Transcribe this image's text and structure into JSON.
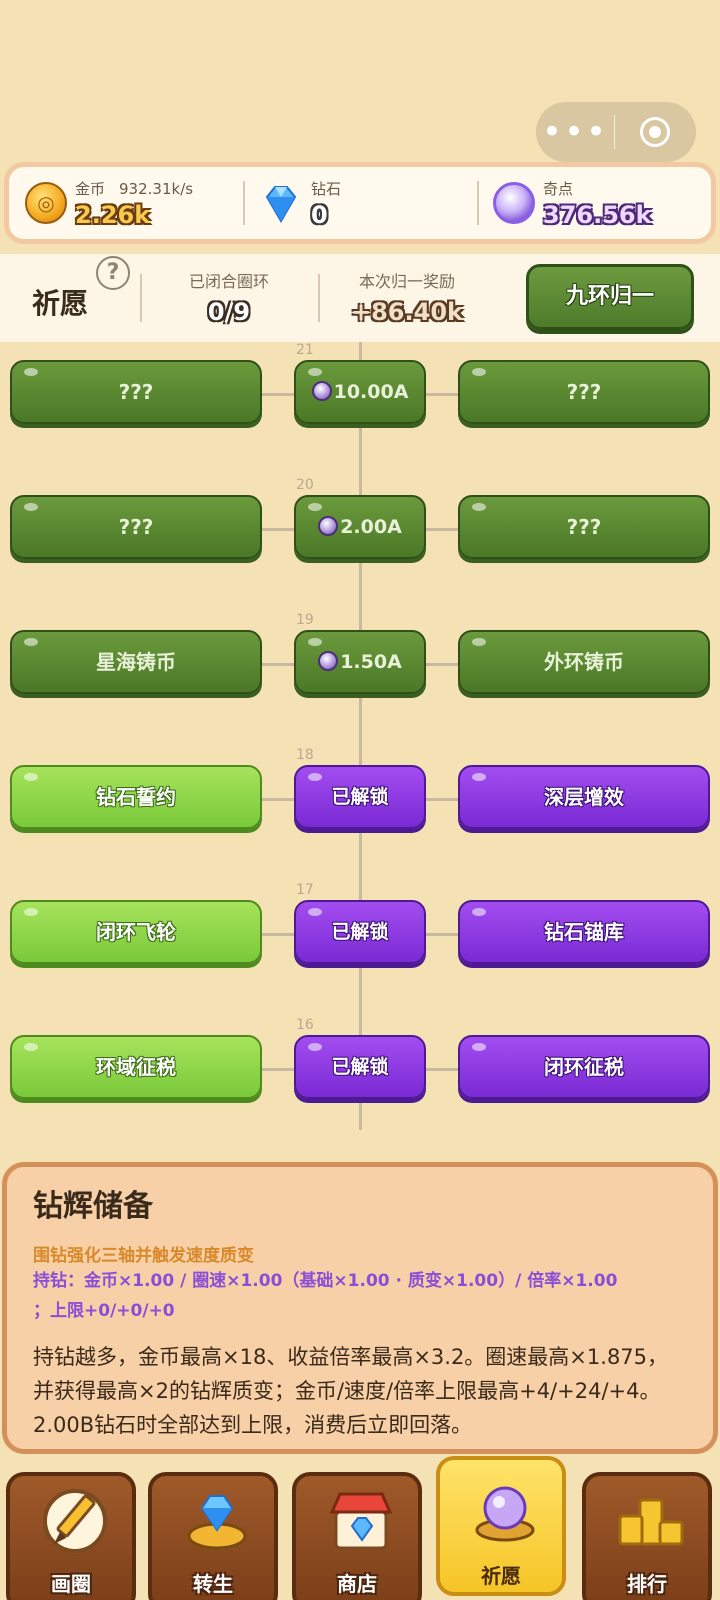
{
  "capsule": {
    "more_icon": "more-dots-icon",
    "close_icon": "target-icon"
  },
  "resources": {
    "gold": {
      "label": "金币",
      "rate": "932.31k/s",
      "value": "2.26k"
    },
    "diamond": {
      "label": "钻石",
      "value": "0"
    },
    "odd": {
      "label": "奇点",
      "value": "376.56k"
    }
  },
  "wish": {
    "title": "祈愿",
    "help": "?",
    "closed_label": "已闭合圈环",
    "closed_value": "0/9",
    "reward_label": "本次归一奖励",
    "reward_value": "+86.40k",
    "button": "九环归一"
  },
  "tiers": [
    {
      "num": "21",
      "left": "???",
      "center": "10.00A",
      "right": "???",
      "state": "locked"
    },
    {
      "num": "20",
      "left": "???",
      "center": "2.00A",
      "right": "???",
      "state": "locked"
    },
    {
      "num": "19",
      "left": "星海铸币",
      "center": "1.50A",
      "right": "外环铸币",
      "state": "locked"
    },
    {
      "num": "18",
      "left": "钻石誓约",
      "center": "已解锁",
      "right": "深层增效",
      "state": "unlocked"
    },
    {
      "num": "17",
      "left": "闭环飞轮",
      "center": "已解锁",
      "right": "钻石锚库",
      "state": "unlocked"
    },
    {
      "num": "16",
      "left": "环域征税",
      "center": "已解锁",
      "right": "闭环征税",
      "state": "unlocked"
    }
  ],
  "detail": {
    "title": "钻辉储备",
    "subtitle": "围钻强化三轴并触发速度质变",
    "stats_line1": "持钻：金币×1.00 / 圈速×1.00（基础×1.00 · 质变×1.00）/ 倍率×1.00",
    "stats_line2": "；上限+0/+0/+0",
    "description": "持钻越多，金币最高×18、收益倍率最高×3.2。圈速最高×1.875，并获得最高×2的钻辉质变；金币/速度/倍率上限最高+4/+24/+4。2.00B钻石时全部达到上限，消费后立即回落。"
  },
  "nav": [
    {
      "label": "画圈",
      "icon": "pencil-icon"
    },
    {
      "label": "转生",
      "icon": "diamond-ring-icon"
    },
    {
      "label": "商店",
      "icon": "shop-icon"
    },
    {
      "label": "祈愿",
      "icon": "crystal-ball-icon",
      "active": true
    },
    {
      "label": "排行",
      "icon": "podium-icon"
    }
  ],
  "colors": {
    "background": "#f5e2b4",
    "locked_green": "#4b7826",
    "unlocked_lime": "#7ac93a",
    "unlocked_purple": "#7a2ad4",
    "active_tab": "#f6c526"
  }
}
